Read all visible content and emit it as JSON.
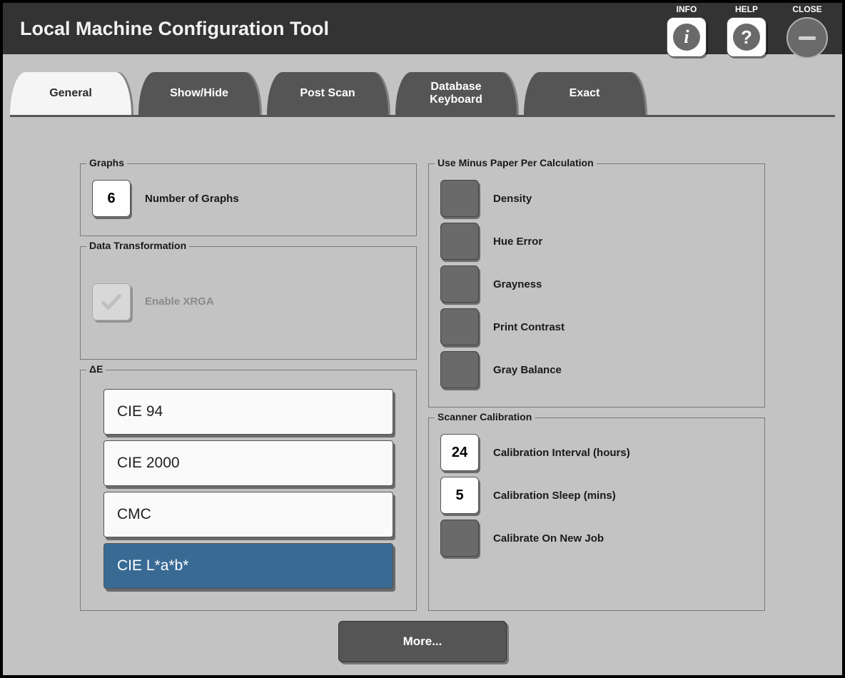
{
  "title": "Local Machine Configuration Tool",
  "topbar": {
    "info_label": "INFO",
    "help_label": "HELP",
    "close_label": "CLOSE"
  },
  "tabs": [
    {
      "label": "General",
      "active": true
    },
    {
      "label": "Show/Hide",
      "active": false
    },
    {
      "label": "Post Scan",
      "active": false
    },
    {
      "label": "Database\nKeyboard",
      "active": false
    },
    {
      "label": "Exact",
      "active": false
    }
  ],
  "graphs": {
    "legend": "Graphs",
    "number_value": "6",
    "number_label": "Number of Graphs"
  },
  "data_transformation": {
    "legend": "Data Transformation",
    "enable_xrga_label": "Enable XRGA",
    "enable_xrga_checked": false,
    "enable_xrga_disabled": true
  },
  "delta_e": {
    "legend": "ΔE",
    "options": [
      {
        "label": "CIE 94",
        "selected": false
      },
      {
        "label": "CIE 2000",
        "selected": false
      },
      {
        "label": "CMC",
        "selected": false
      },
      {
        "label": "CIE L*a*b*",
        "selected": true
      }
    ]
  },
  "minus_paper": {
    "legend": "Use Minus Paper Per Calculation",
    "items": [
      {
        "label": "Density",
        "checked": false
      },
      {
        "label": "Hue Error",
        "checked": false
      },
      {
        "label": "Grayness",
        "checked": false
      },
      {
        "label": "Print Contrast",
        "checked": false
      },
      {
        "label": "Gray Balance",
        "checked": false
      }
    ]
  },
  "scanner_calibration": {
    "legend": "Scanner Calibration",
    "interval_value": "24",
    "interval_label": "Calibration Interval (hours)",
    "sleep_value": "5",
    "sleep_label": "Calibration Sleep (mins)",
    "calibrate_new_job_label": "Calibrate On New Job",
    "calibrate_new_job_checked": false
  },
  "more_label": "More..."
}
